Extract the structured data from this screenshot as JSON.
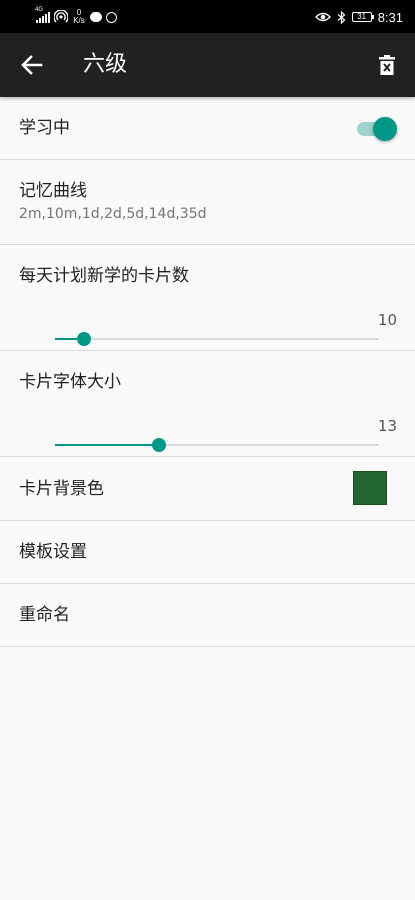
{
  "status_bar": {
    "signal_label": "4G",
    "net_speed_value": "0",
    "net_speed_unit": "K/s",
    "battery": "31",
    "time": "8:31"
  },
  "app_bar": {
    "title": "六级",
    "back_icon": "arrow-left-icon",
    "delete_icon": "trash-icon"
  },
  "settings": {
    "learning": {
      "label": "学习中",
      "on": true
    },
    "memory_curve": {
      "label": "记忆曲线",
      "value": "2m,10m,1d,2d,5d,14d,35d"
    },
    "daily_new_cards": {
      "label": "每天计划新学的卡片数",
      "value": "10",
      "level": 0.09
    },
    "card_font_size": {
      "label": "卡片字体大小",
      "value": "13",
      "level": 0.32
    },
    "card_bg_color": {
      "label": "卡片背景色",
      "color": "#246633"
    },
    "template_settings": {
      "label": "模板设置"
    },
    "rename": {
      "label": "重命名"
    }
  },
  "colors": {
    "accent": "#009688",
    "app_bar": "#212121",
    "status_bar": "#000000"
  }
}
